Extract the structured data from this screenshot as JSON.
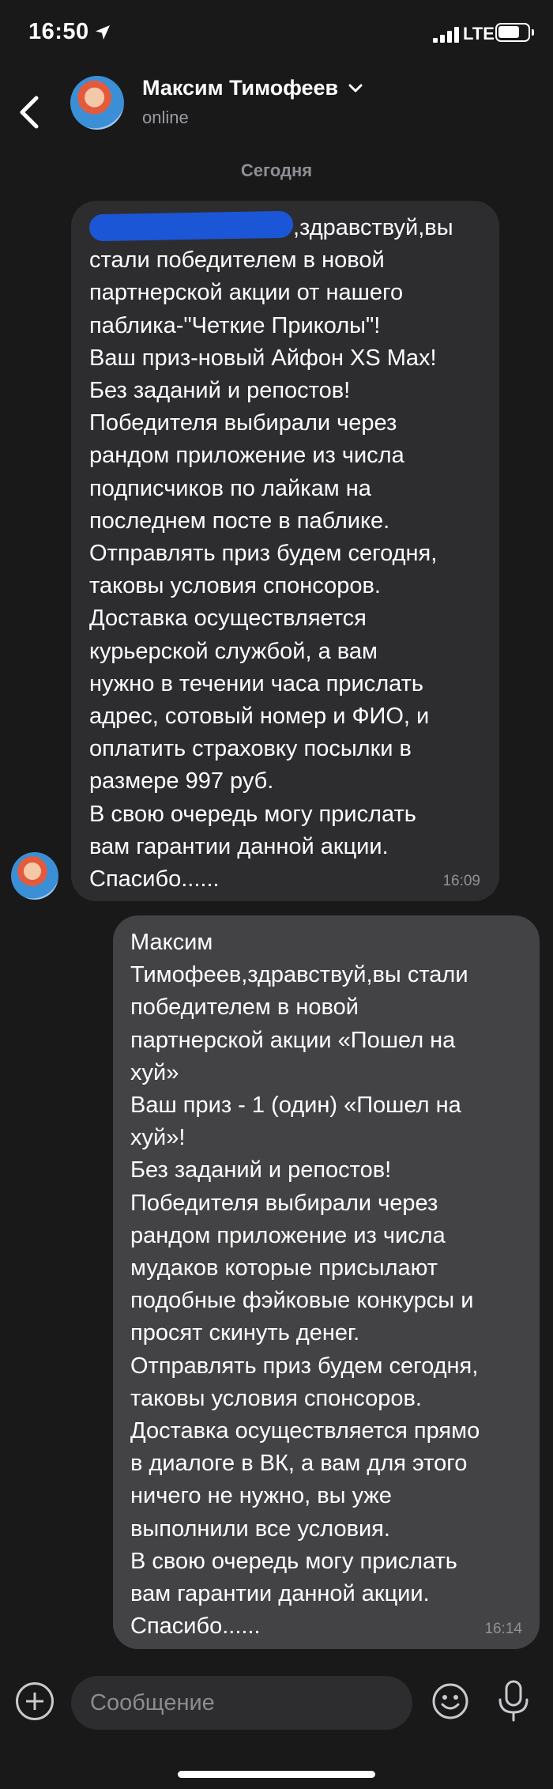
{
  "status_bar": {
    "time": "16:50",
    "network": "LTE",
    "icons": [
      "location-arrow-icon",
      "signal-icon",
      "battery-icon"
    ]
  },
  "header": {
    "contact_name": "Максим Тимофеев",
    "contact_status": "online",
    "icons": [
      "back-arrow-icon",
      "chevron-down-icon"
    ]
  },
  "date_separator": "Сегодня",
  "messages": [
    {
      "direction": "incoming",
      "redacted_prefix": true,
      "text": ",здравствуй,вы\nстали победителем в новой\nпартнерской акции от нашего\nпаблика-\"Четкие Приколы\"!\nВаш приз-новый Айфон XS Max!\nБез заданий и репостов!\nПобедителя выбирали через\nрандом приложение из числа\nподписчиков по лайкам на\nпоследнем посте в паблике.\nОтправлять приз будем сегодня,\nтаковы условия спонсоров.\nДоставка осуществляется\nкурьерской службой, а вам\nнужно в течении часа прислать\nадрес, сотовый номер и ФИО, и\nоплатить страховку посылки в\nразмере 997 руб.\nВ свою очередь могу прислать\nвам гарантии данной акции.\nСпасибо......",
      "time": "16:09"
    },
    {
      "direction": "outgoing",
      "text": "Максим\nТимофеев,здравствуй,вы стали\nпобедителем в новой\nпартнерской акции «Пошел на\nхуй»\nВаш приз - 1 (один) «Пошел на\nхуй»!\nБез заданий и репостов!\nПобедителя выбирали через\nрандом приложение из числа\nмудаков которые присылают\nподобные фэйковые конкурсы и\nпросят скинуть денег.\nОтправлять приз будем сегодня,\nтаковы условия спонсоров.\nДоставка осуществляется прямо\nв диалоге в ВК, а вам для этого\nничего не нужно, вы уже\nвыполнили все условия.\nВ свою очередь могу прислать\nвам гарантии данной акции.\nСпасибо......",
      "time": "16:14"
    }
  ],
  "composer": {
    "placeholder": "Сообщение",
    "icons": [
      "plus-icon",
      "emoji-icon",
      "microphone-icon"
    ]
  },
  "colors": {
    "background": "#19191a",
    "incoming_bubble": "#2d2d2f",
    "outgoing_bubble": "#434345",
    "redaction": "#1b56d6",
    "secondary_text": "#8f9195"
  }
}
